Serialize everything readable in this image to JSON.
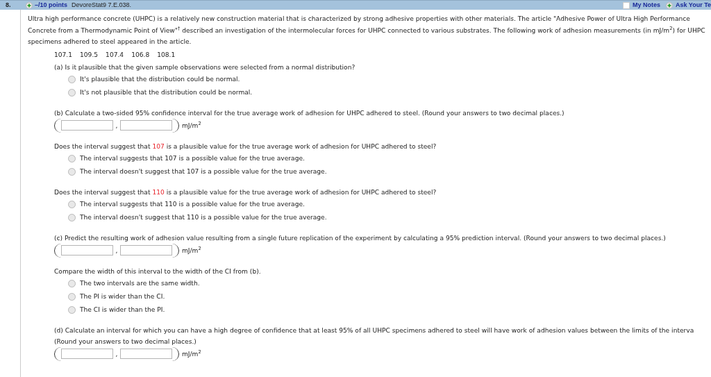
{
  "header": {
    "number": "8.",
    "points": "–/10 points",
    "source": "DevoreStat9 7.E.038.",
    "my_notes": {
      "label": "My Notes",
      "checked": false
    },
    "ask": "Ask Your Te"
  },
  "intro": "Ultra high performance concrete (UHPC) is a relatively new construction material that is characterized by strong adhesive properties with other materials. The article \"Adhesive Power of Ultra High Performance Concrete from a Thermodynamic Point of View\"$^{†}$ described an investigation of the intermolecular forces for UHPC connected to various substrates. The following work of adhesion measurements (in mJ/m$^{2}$) for UHPC specimens adhered to steel appeared in the article.",
  "data_values": [
    "107.1",
    "109.5",
    "107.4",
    "106.8",
    "108.1"
  ],
  "blocks": [
    {
      "kind": "prompt",
      "text": "(a) Is it plausible that the given sample observations were selected from a normal distribution?"
    },
    {
      "kind": "radio",
      "options": [
        {
          "label": "It's plausible that the distribution could be normal.",
          "selected": false
        },
        {
          "label": "It's not plausible that the distribution could be normal.",
          "selected": false
        }
      ]
    },
    {
      "kind": "prompt",
      "text": "(b) Calculate a two-sided 95% confidence interval for the true average work of adhesion for UHPC adhered to steel. (Round your answers to two decimal places.)"
    },
    {
      "kind": "interval",
      "separator": ",",
      "unit": "mJ/m$^{2}$"
    },
    {
      "kind": "highlight_prompt",
      "before": "Does the interval suggest that",
      "value": "107",
      "after": "is a plausible value for the true average work of adhesion for UHPC adhered to steel?"
    },
    {
      "kind": "radio",
      "options": [
        {
          "label": "The interval suggests that 107 is a possible value for the true average.",
          "selected": false
        },
        {
          "label": "The interval doesn't suggest that 107 is a possible value for the true average.",
          "selected": false
        }
      ]
    },
    {
      "kind": "highlight_prompt",
      "before": "Does the interval suggest that",
      "value": "110",
      "after": "is a plausible value for the true average work of adhesion for UHPC adhered to steel?"
    },
    {
      "kind": "radio",
      "options": [
        {
          "label": "The interval suggests that 110 is a possible value for the true average.",
          "selected": false
        },
        {
          "label": "The interval doesn't suggest that 110 is a possible value for the true average.",
          "selected": false
        }
      ]
    },
    {
      "kind": "prompt",
      "text": "(c) Predict the resulting work of adhesion value resulting from a single future replication of the experiment by calculating a 95% prediction interval. (Round your answers to two decimal places.)"
    },
    {
      "kind": "interval",
      "separator": ",",
      "unit": "mJ/m$^{2}$"
    },
    {
      "kind": "prompt",
      "text": "Compare the width of this interval to the width of the CI from (b)."
    },
    {
      "kind": "radio",
      "options": [
        {
          "label": "The two intervals are the same width.",
          "selected": false
        },
        {
          "label": "The PI is wider than the CI.",
          "selected": false
        },
        {
          "label": "The CI is wider than the PI.",
          "selected": false
        }
      ]
    },
    {
      "kind": "prompt",
      "text": "(d) Calculate an interval for which you can have a high degree of confidence that at least 95% of all UHPC specimens adhered to steel will have work of adhesion values between the limits of the interva"
    },
    {
      "kind": "continuation",
      "text": "(Round your answers to two decimal places.)"
    },
    {
      "kind": "interval",
      "separator": ",",
      "unit": "mJ/m$^{2}$"
    }
  ]
}
